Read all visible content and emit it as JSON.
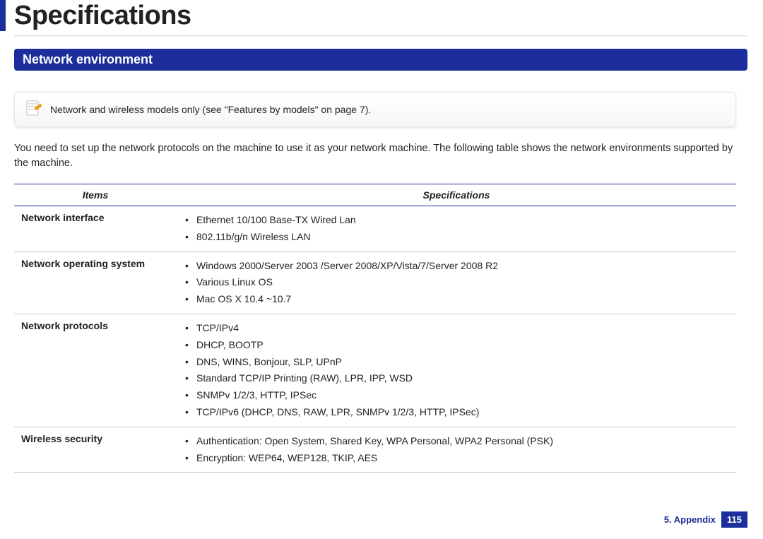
{
  "title": "Specifications",
  "section": "Network environment",
  "note": "Network and wireless models only (see \"Features by models\" on page 7).",
  "intro": "You need to set up the network protocols on the machine to use it as your network machine. The following table shows the network environments supported by the machine.",
  "table": {
    "headers": [
      "Items",
      "Specifications"
    ],
    "rows": [
      {
        "item": "Network interface",
        "specs": [
          "Ethernet 10/100 Base-TX Wired Lan",
          "802.11b/g/n Wireless LAN"
        ]
      },
      {
        "item": "Network operating system",
        "specs": [
          "Windows 2000/Server 2003 /Server 2008/XP/Vista/7/Server 2008 R2",
          "Various Linux OS",
          "Mac OS X 10.4 ~10.7"
        ]
      },
      {
        "item": "Network protocols",
        "specs": [
          "TCP/IPv4",
          "DHCP, BOOTP",
          "DNS, WINS, Bonjour, SLP, UPnP",
          "Standard TCP/IP Printing (RAW), LPR, IPP, WSD",
          "SNMPv 1/2/3, HTTP, IPSec",
          "TCP/IPv6 (DHCP, DNS, RAW, LPR, SNMPv 1/2/3, HTTP, IPSec)"
        ]
      },
      {
        "item": "Wireless security",
        "specs": [
          "Authentication: Open System, Shared Key, WPA Personal, WPA2 Personal (PSK)",
          "Encryption: WEP64, WEP128, TKIP, AES"
        ]
      }
    ]
  },
  "footer": {
    "chapter": "5.  Appendix",
    "page": "115"
  }
}
